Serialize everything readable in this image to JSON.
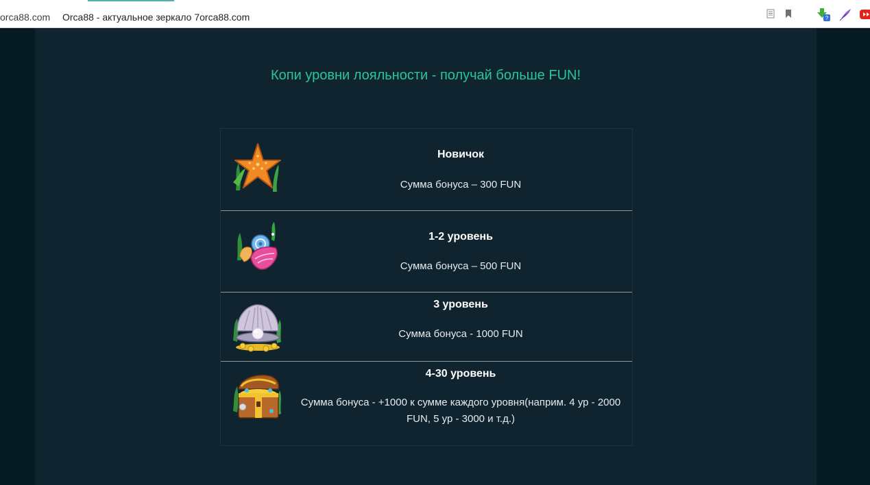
{
  "browser": {
    "url_domain": "orca88.com",
    "page_title": "Orca88 - актуальное зеркало 7orca88.com",
    "icons": [
      "reader-mode-icon",
      "bookmark-icon",
      "download-extension-icon",
      "feather-extension-icon",
      "youtube-extension-icon"
    ]
  },
  "page": {
    "heading": "Копи уровни лояльности - получай больше FUN!",
    "levels": [
      {
        "icon": "starfish-icon",
        "title": "Новичок",
        "bonus": "Сумма бонуса – 300 FUN"
      },
      {
        "icon": "seashells-icon",
        "title": "1-2 уровень",
        "bonus": "Сумма бонуса – 500 FUN"
      },
      {
        "icon": "pearl-clam-icon",
        "title": "3 уровень",
        "bonus": "Сумма бонуса - 1000 FUN"
      },
      {
        "icon": "treasure-chest-icon",
        "title": "4-30 уровень",
        "bonus": "Сумма бонуса - +1000 к сумме каждого уровня(наприм. 4 ур - 2000 FUN, 5 ур - 3000 и т.д.)"
      }
    ]
  },
  "colors": {
    "heading_accent": "#27c69c",
    "content_bg": "#10242f",
    "outer_bg": "#061a22",
    "row_divider": "#8d9aa0"
  }
}
